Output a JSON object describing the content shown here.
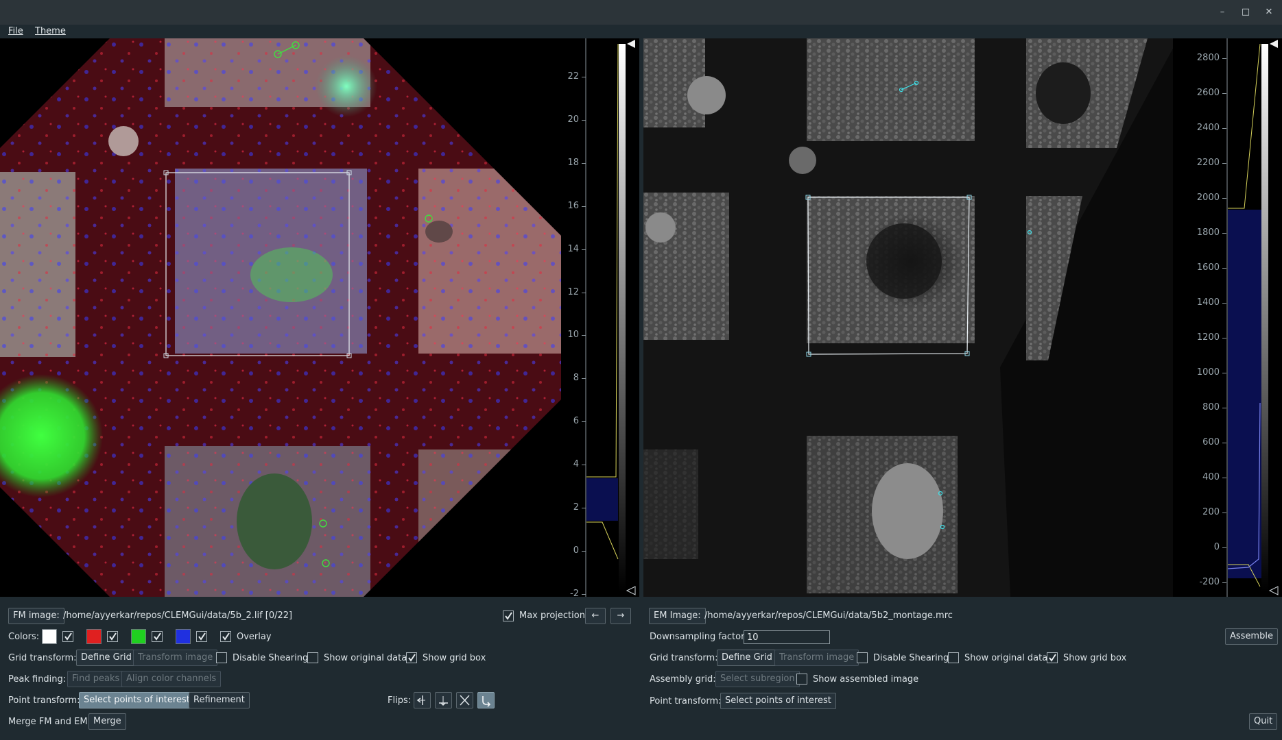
{
  "menu": {
    "file": "File",
    "theme": "Theme"
  },
  "window_controls": {
    "minimize": "–",
    "maximize": "□",
    "close": "✕"
  },
  "fm": {
    "histogram_ticks": [
      "22",
      "20",
      "18",
      "16",
      "14",
      "12",
      "10",
      "8",
      "6",
      "4",
      "2",
      "0",
      "-2"
    ],
    "image_button": "FM image:",
    "path": "/home/ayyerkar/repos/CLEMGui/data/5b_2.lif [0/22]",
    "max_projection_label": "Max projection",
    "max_projection_checked": true,
    "prev_arrow": "←",
    "next_arrow": "→",
    "colors_label": "Colors:",
    "channels": [
      {
        "color": "#ffffff",
        "checked": true
      },
      {
        "color": "#e02020",
        "checked": true
      },
      {
        "color": "#20d020",
        "checked": true
      },
      {
        "color": "#2030e0",
        "checked": true
      }
    ],
    "overlay_label": "Overlay",
    "grid_transform_label": "Grid transform:",
    "define_grid": "Define Grid",
    "transform_image": "Transform image",
    "disable_shearing": "Disable Shearing",
    "show_original": "Show original data",
    "show_grid_box": "Show grid box",
    "peak_finding_label": "Peak finding:",
    "find_peaks": "Find peaks",
    "align_channels": "Align color channels",
    "point_transform_label": "Point transform:",
    "select_poi": "Select points of interest",
    "refinement": "Refinement",
    "flips_label": "Flips:",
    "merge_label": "Merge FM and EM:",
    "merge_button": "Merge"
  },
  "em": {
    "histogram_ticks": [
      "2800",
      "2600",
      "2400",
      "2200",
      "2000",
      "1800",
      "1600",
      "1400",
      "1200",
      "1000",
      "800",
      "600",
      "400",
      "200",
      "0",
      "-200"
    ],
    "image_button": "EM Image:",
    "path": "/home/ayyerkar/repos/CLEMGui/data/5b2_montage.mrc",
    "downsampling_label": "Downsampling factor:",
    "downsampling_value": "10",
    "assemble": "Assemble",
    "grid_transform_label": "Grid transform:",
    "define_grid": "Define Grid",
    "transform_image": "Transform image",
    "disable_shearing": "Disable Shearing",
    "show_original": "Show original data",
    "show_grid_box": "Show grid box",
    "assembly_grid_label": "Assembly grid:",
    "select_subregion": "Select subregion",
    "show_assembled": "Show assembled image",
    "point_transform_label": "Point transform:",
    "select_poi": "Select points of interest",
    "quit": "Quit"
  }
}
